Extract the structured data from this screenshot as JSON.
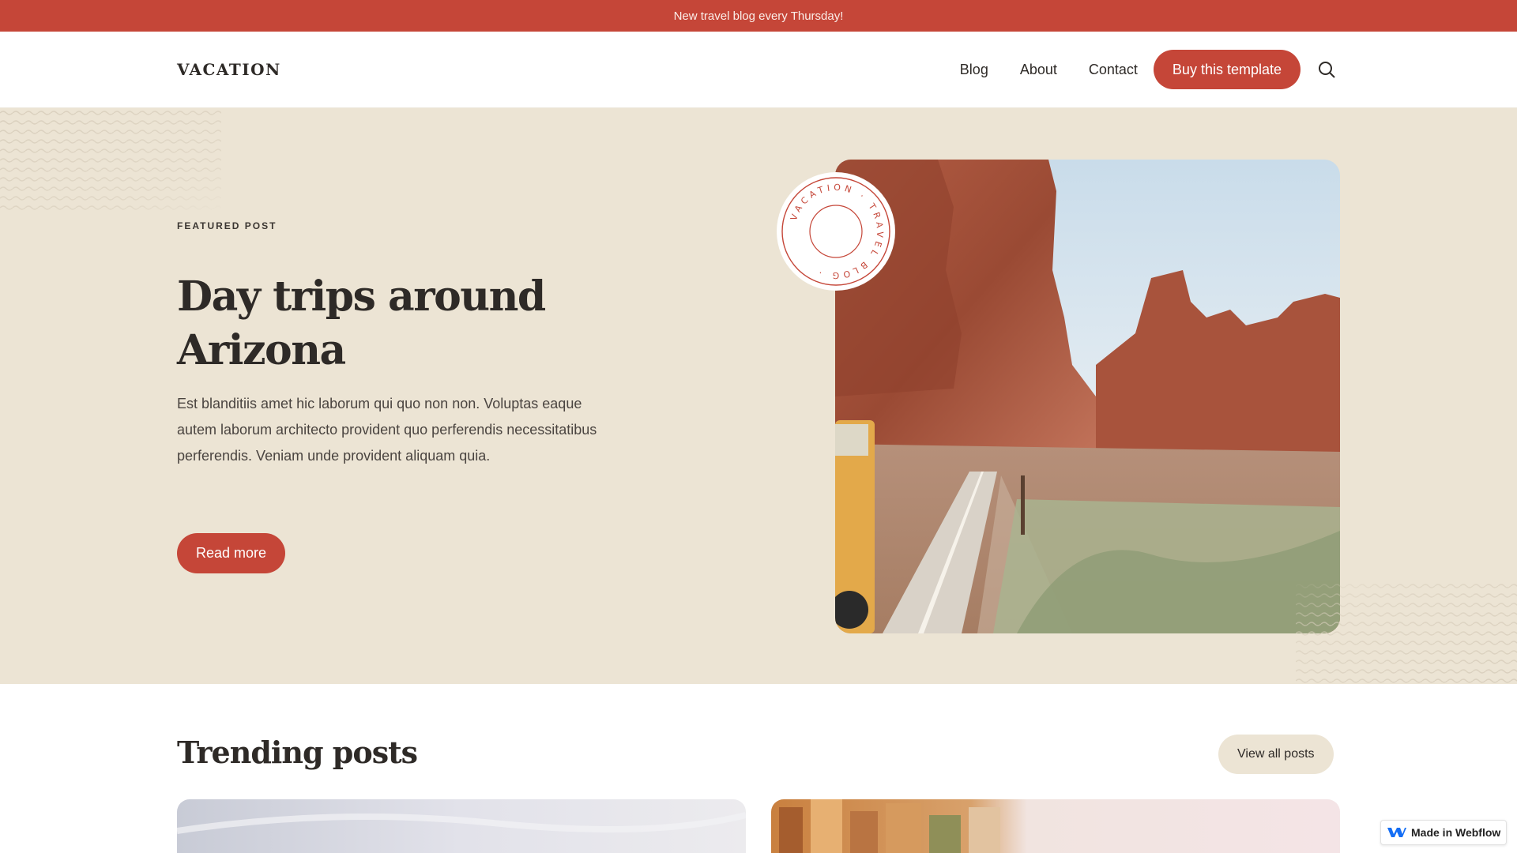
{
  "announcement": {
    "text": "New travel blog every Thursday!"
  },
  "header": {
    "logo": "VACATION",
    "nav": [
      "Blog",
      "About",
      "Contact"
    ],
    "cta": "Buy this template"
  },
  "hero": {
    "eyebrow": "FEATURED POST",
    "title": "Day trips around Arizona",
    "text": "Est blanditiis amet hic laborum qui quo non non. Voluptas eaque autem laborum architecto provident quo perferendis necessitatibus perferendis. Veniam unde provident aliquam quia.",
    "button": "Read more",
    "badge_text": "VACATION · TRAVEL BLOG ·"
  },
  "trending": {
    "title": "Trending posts",
    "button": "View all posts"
  },
  "badge": {
    "label": "Made in Webflow"
  },
  "colors": {
    "accent": "#c54638",
    "sand": "#ece4d4",
    "text": "#2e2a27"
  }
}
